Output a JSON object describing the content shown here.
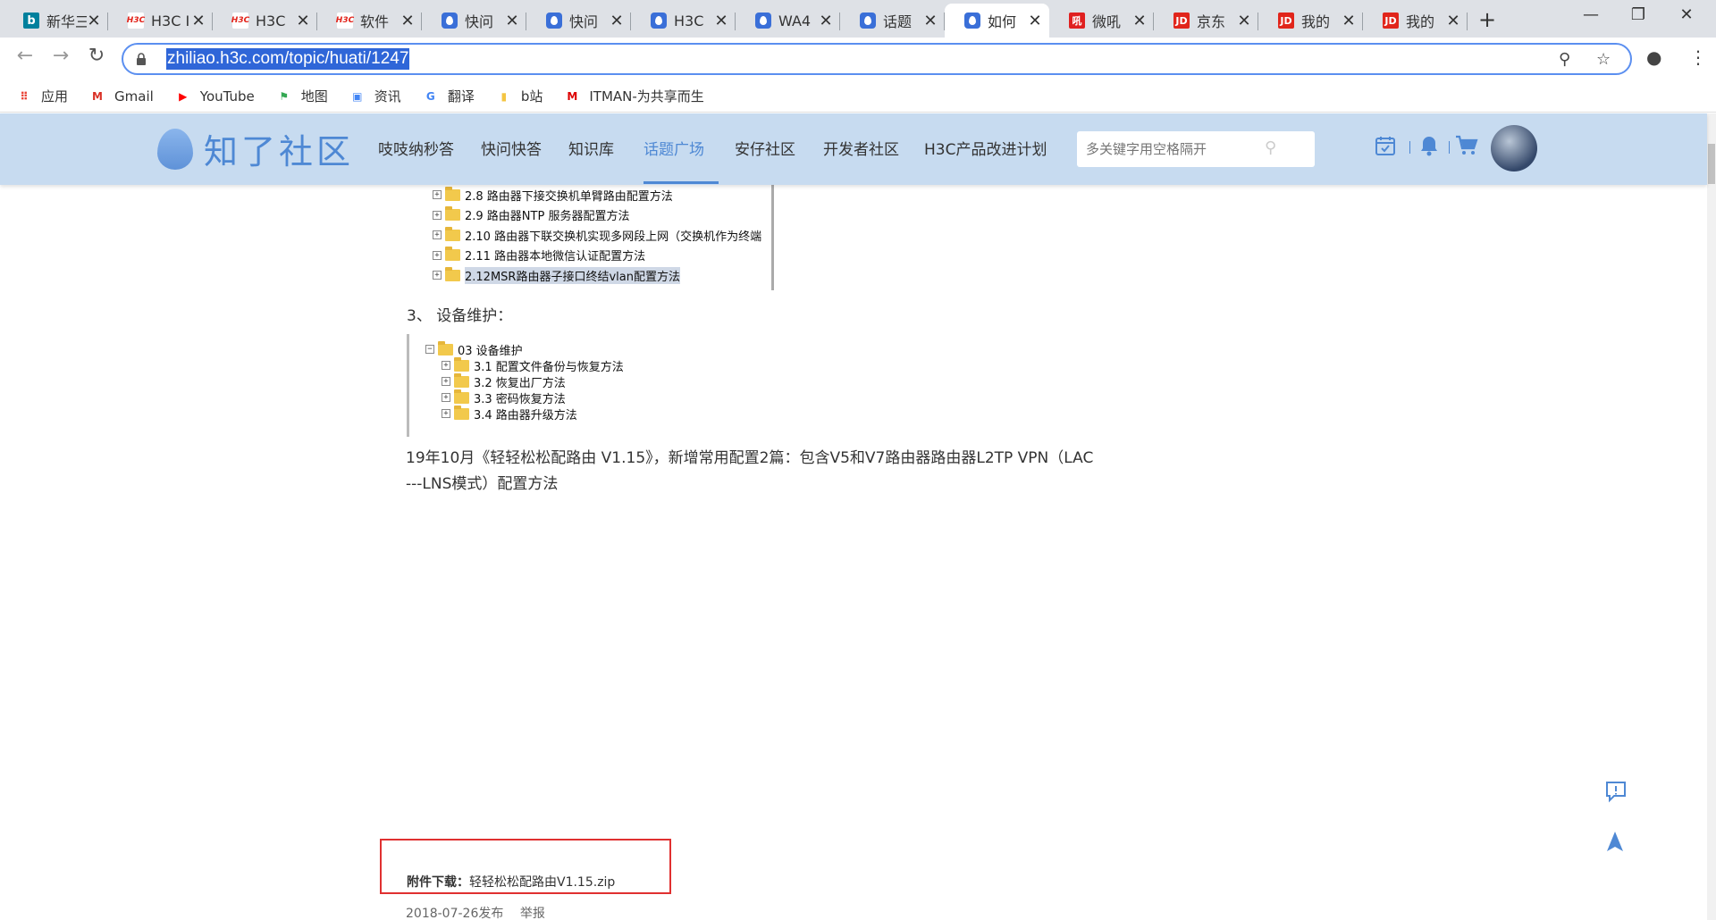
{
  "tabs": [
    {
      "title": "新华三",
      "icon": "bing",
      "active": false
    },
    {
      "title": "H3C I",
      "icon": "h3c",
      "active": false
    },
    {
      "title": "H3C",
      "icon": "h3c",
      "active": false
    },
    {
      "title": "软件",
      "icon": "h3c",
      "active": false
    },
    {
      "title": "快问",
      "icon": "zhiliao",
      "active": false
    },
    {
      "title": "快问",
      "icon": "zhiliao",
      "active": false
    },
    {
      "title": "H3C",
      "icon": "zhiliao",
      "active": false
    },
    {
      "title": "WA4",
      "icon": "zhiliao",
      "active": false
    },
    {
      "title": "话题",
      "icon": "zhiliao",
      "active": false
    },
    {
      "title": "如何",
      "icon": "zhiliao",
      "active": true
    },
    {
      "title": "微吼",
      "icon": "weihou",
      "active": false
    },
    {
      "title": "京东",
      "icon": "jd",
      "active": false
    },
    {
      "title": "我的",
      "icon": "jd",
      "active": false
    },
    {
      "title": "我的",
      "icon": "jd",
      "active": false
    }
  ],
  "toolbar": {
    "url": "zhiliao.h3c.com/topic/huati/1247"
  },
  "bookmarks": [
    {
      "label": "应用",
      "icon": "apps-grid-icon"
    },
    {
      "label": "Gmail",
      "icon": "gmail-icon"
    },
    {
      "label": "YouTube",
      "icon": "youtube-icon"
    },
    {
      "label": "地图",
      "icon": "maps-icon"
    },
    {
      "label": "资讯",
      "icon": "news-icon"
    },
    {
      "label": "翻译",
      "icon": "translate-icon"
    },
    {
      "label": "b站",
      "icon": "folder-icon"
    },
    {
      "label": "ITMAN-为共享而生",
      "icon": "itman-icon"
    }
  ],
  "header": {
    "logo_text": "知了社区",
    "nav": [
      {
        "label": "吱吱纳秒答",
        "active": false
      },
      {
        "label": "快问快答",
        "active": false
      },
      {
        "label": "知识库",
        "active": false
      },
      {
        "label": "话题广场",
        "active": true
      },
      {
        "label": "安仔社区",
        "active": false
      },
      {
        "label": "开发者社区",
        "active": false
      },
      {
        "label": "H3C产品改进计划",
        "active": false
      }
    ],
    "search_placeholder": "多关键字用空格隔开"
  },
  "content": {
    "tree1": [
      {
        "label": "2.8 路由器下接交换机单臂路由配置方法",
        "highlight": false
      },
      {
        "label": "2.9 路由器NTP 服务器配置方法",
        "highlight": false
      },
      {
        "label": "2.10 路由器下联交换机实现多网段上网（交换机作为终端",
        "highlight": false
      },
      {
        "label": "2.11 路由器本地微信认证配置方法",
        "highlight": false
      },
      {
        "label": "2.12MSR路由器子接口终结vlan配置方法",
        "highlight": true
      }
    ],
    "step3": "3、  设备维护：",
    "tree2_root": "03 设备维护",
    "tree2": [
      "3.1 配置文件备份与恢复方法",
      "3.2 恢复出厂方法",
      "3.3 密码恢复方法",
      "3.4 路由器升级方法"
    ],
    "paragraph_line1": "19年10月《轻轻松松配路由 V1.15》，新增常用配置2篇：包含V5和V7路由器路由器L2TP VPN（LAC",
    "paragraph_line2": "---LNS模式）配置方法",
    "attachment_label": "附件下载：",
    "attachment_file": "轻轻松松配路由V1.15.zip",
    "published": "2018-07-26发布",
    "report": "举报"
  }
}
